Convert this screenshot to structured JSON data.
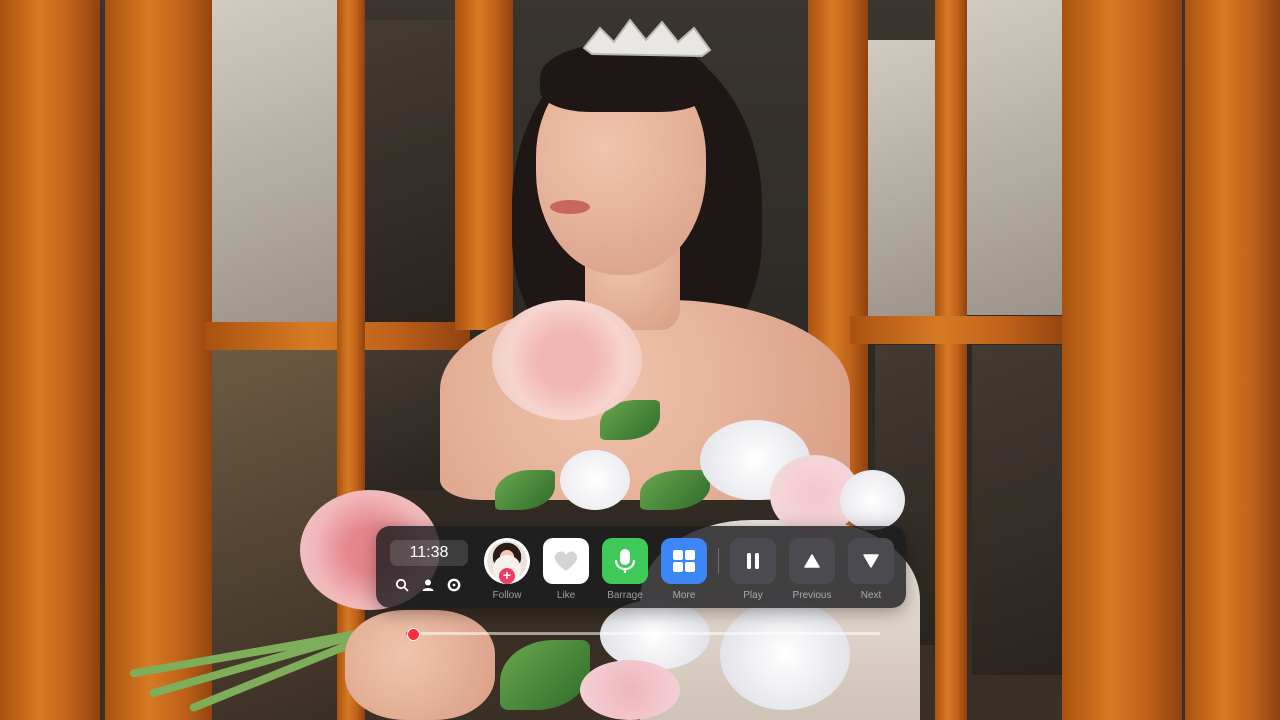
{
  "clock": {
    "time": "11:38"
  },
  "controls": [
    {
      "key": "follow",
      "label": "Follow",
      "icon": "avatar-follow-icon",
      "color": "#ffffff"
    },
    {
      "key": "like",
      "label": "Like",
      "icon": "heart-icon",
      "color": "#ffffff"
    },
    {
      "key": "barrage",
      "label": "Barrage",
      "icon": "microphone-icon",
      "color": "#3fc959"
    },
    {
      "key": "more",
      "label": "More",
      "icon": "grid-icon",
      "color": "#3d86f5"
    },
    {
      "key": "play",
      "label": "Play",
      "icon": "pause-icon",
      "color": "#4a4a50"
    },
    {
      "key": "previous",
      "label": "Previous",
      "icon": "triangle-up-icon",
      "color": "#4a4a50"
    },
    {
      "key": "next",
      "label": "Next",
      "icon": "triangle-down-icon",
      "color": "#4a4a50"
    }
  ],
  "mini_icons": [
    "search-icon",
    "user-icon",
    "settings-icon"
  ],
  "progress": {
    "fraction": 0.015,
    "color": "#ff3b47"
  }
}
